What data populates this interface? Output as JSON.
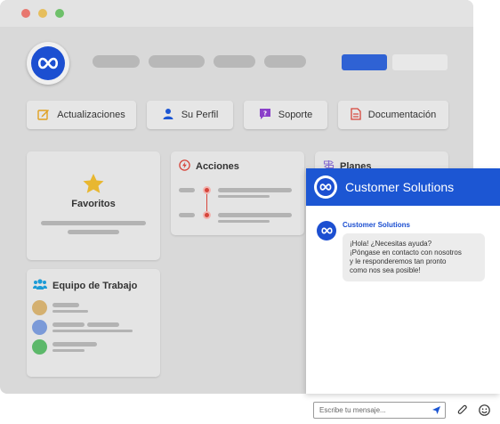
{
  "window": {
    "dot_colors": [
      "#e8776f",
      "#e6be5c",
      "#6ec06a"
    ]
  },
  "nav": {
    "items": [
      {
        "label": "Actualizaciones",
        "icon": "edit-icon",
        "color": "#e0a020"
      },
      {
        "label": "Su Perfil",
        "icon": "user-icon",
        "color": "#1c56d3"
      },
      {
        "label": "Soporte",
        "icon": "help-chat-icon",
        "color": "#8a3fc9"
      },
      {
        "label": "Documentación",
        "icon": "document-icon",
        "color": "#d6453b"
      }
    ]
  },
  "cards": {
    "favoritos": {
      "label": "Favoritos",
      "icon": "star-icon",
      "color": "#e8b730"
    },
    "acciones": {
      "label": "Acciones",
      "icon": "bolt-icon",
      "color": "#d6453b"
    },
    "planes": {
      "label": "Planes",
      "icon": "signpost-icon",
      "color": "#8a6fd1"
    },
    "equipo": {
      "label": "Equipo de Trabajo",
      "icon": "team-icon",
      "color": "#1c9bd6",
      "member_colors": [
        "#d4b070",
        "#7b9ad8",
        "#5cb86a"
      ]
    }
  },
  "chat": {
    "header_title": "Customer Solutions",
    "sender_name": "Customer Solutions",
    "message_lines": [
      "¡Hola! ¿Necesitas ayuda?",
      "¡Póngase en contacto con nosotros",
      "y le responderemos tan pronto",
      "como nos sea posible!"
    ],
    "input_placeholder": "Escribe tu mensaje...",
    "brand_color": "#1c56d3"
  }
}
